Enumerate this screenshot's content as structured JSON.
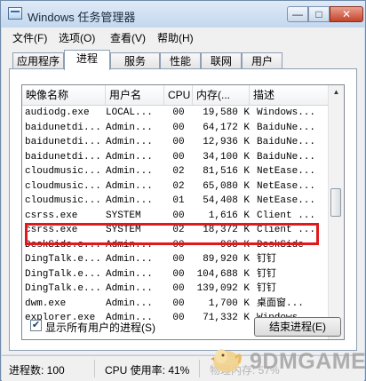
{
  "window": {
    "title": "Windows 任务管理器"
  },
  "title_controls": {
    "minimize": "—",
    "maximize": "□",
    "close": "✕"
  },
  "menu": [
    "文件(F)",
    "选项(O)",
    "查看(V)",
    "帮助(H)"
  ],
  "tabs": [
    "应用程序",
    "进程",
    "服务",
    "性能",
    "联网",
    "用户"
  ],
  "active_tab": "进程",
  "columns": [
    "映像名称",
    "用户名",
    "CPU",
    "内存(...",
    "描述"
  ],
  "processes": [
    {
      "name": "audiodg.exe",
      "user": "LOCAL...",
      "cpu": "00",
      "mem": "19,580 K",
      "desc": "Windows..."
    },
    {
      "name": "baidunetdi...",
      "user": "Admin...",
      "cpu": "00",
      "mem": "64,172 K",
      "desc": "BaiduNe..."
    },
    {
      "name": "baidunetdi...",
      "user": "Admin...",
      "cpu": "00",
      "mem": "12,936 K",
      "desc": "BaiduNe..."
    },
    {
      "name": "baidunetdi...",
      "user": "Admin...",
      "cpu": "00",
      "mem": "34,100 K",
      "desc": "BaiduNe..."
    },
    {
      "name": "cloudmusic...",
      "user": "Admin...",
      "cpu": "02",
      "mem": "81,516 K",
      "desc": "NetEase..."
    },
    {
      "name": "cloudmusic...",
      "user": "Admin...",
      "cpu": "02",
      "mem": "65,080 K",
      "desc": "NetEase..."
    },
    {
      "name": "cloudmusic...",
      "user": "Admin...",
      "cpu": "01",
      "mem": "54,408 K",
      "desc": "NetEase..."
    },
    {
      "name": "csrss.exe",
      "user": "SYSTEM",
      "cpu": "00",
      "mem": "1,616 K",
      "desc": "Client ..."
    },
    {
      "name": "csrss.exe",
      "user": "SYSTEM",
      "cpu": "02",
      "mem": "18,372 K",
      "desc": "Client ..."
    },
    {
      "name": "DeskSide.e...",
      "user": "Admin...",
      "cpu": "00",
      "mem": "968 K",
      "desc": "DeskSide"
    },
    {
      "name": "DingTalk.e...",
      "user": "Admin...",
      "cpu": "00",
      "mem": "89,920 K",
      "desc": "钉钉"
    },
    {
      "name": "DingTalk.e...",
      "user": "Admin...",
      "cpu": "00",
      "mem": "104,688 K",
      "desc": "钉钉"
    },
    {
      "name": "DingTalk.e...",
      "user": "Admin...",
      "cpu": "00",
      "mem": "139,092 K",
      "desc": "钉钉"
    },
    {
      "name": "dwm.exe",
      "user": "Admin...",
      "cpu": "00",
      "mem": "1,700 K",
      "desc": "桌面窗..."
    },
    {
      "name": "explorer.exe",
      "user": "Admin...",
      "cpu": "00",
      "mem": "71,332 K",
      "desc": "Windows..."
    }
  ],
  "show_all_users": {
    "label": "显示所有用户的进程(S)",
    "checked": true
  },
  "end_process_button": "结束进程(E)",
  "status": {
    "process_count": "进程数: 100",
    "cpu_usage": "CPU 使用率: 41%",
    "memory": "物理内存: 57%"
  },
  "watermark": "9DMGAME",
  "colors": {
    "highlight_border": "#e0191c",
    "titlebar": "#c3d7ee",
    "close_button": "#c4432b"
  }
}
